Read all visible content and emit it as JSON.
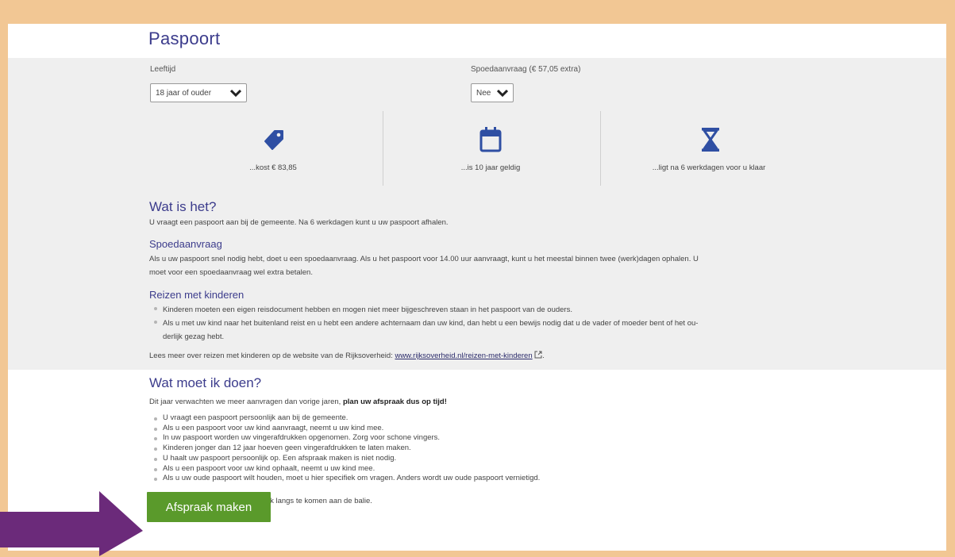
{
  "page": {
    "title": "Paspoort"
  },
  "filters": {
    "age_label": "Leeftijd",
    "age_value": "18 jaar of ouder",
    "speed_label": "Spoedaanvraag (€ 57,05 extra)",
    "speed_value": "Nee"
  },
  "stats": [
    {
      "icon": "price-tag-icon",
      "text": "...kost € 83,85"
    },
    {
      "icon": "calendar-icon",
      "text": "...is 10 jaar geldig"
    },
    {
      "icon": "hourglass-icon",
      "text": "...ligt na 6 werkdagen voor u klaar"
    }
  ],
  "what": {
    "heading": "Wat is het?",
    "text": "U vraagt een paspoort aan bij de gemeente. Na 6 werkdagen kunt u uw paspoort afhalen."
  },
  "spoed": {
    "heading": "Spoedaanvraag",
    "line1": "Als u uw paspoort snel nodig hebt, doet u een spoedaanvraag. Als u het paspoort voor 14.00 uur aanvraagt, kunt u het meestal binnen twee (werk)dagen ophalen. U",
    "line2": "moet voor een spoedaanvraag wel extra betalen."
  },
  "kinderen": {
    "heading": "Reizen met kinderen",
    "bullets": [
      "Kinderen moeten een eigen reisdocument hebben en mogen niet meer bijgeschreven staan in het paspoort van de ouders.",
      "Als u met uw kind naar het buitenland reist en u hebt een andere achternaam dan uw kind, dan hebt u een bewijs nodig dat u de vader of moeder bent of het ou-",
      "derlijk gezag hebt."
    ],
    "more_text": "Lees meer over reizen met kinderen op de website van de Rijksoverheid:",
    "more_link": "www.rijksoverheid.nl/reizen-met-kinderen",
    "more_end": "."
  },
  "todo": {
    "heading": "Wat moet ik doen?",
    "intro": "Dit jaar verwachten we meer aanvragen dan vorige jaren,",
    "intro_bold": "plan uw afspraak dus op tijd!",
    "bullets": [
      "U vraagt een paspoort persoonlijk aan bij de gemeente.",
      "Als u een paspoort voor uw kind aanvraagt, neemt u uw kind mee.",
      "In uw paspoort worden uw vingerafdrukken opgenomen. Zorg voor schone vingers.",
      "Kinderen jonger dan 12 jaar hoeven geen vingerafdrukken te laten maken.",
      "U haalt uw paspoort persoonlijk op. Een afspraak maken is niet nodig.",
      "Als u een paspoort voor uw kind ophaalt, neemt u uw kind mee.",
      "Als u uw oude paspoort wilt houden, moet u hier specifiek om vragen. Anders wordt uw oude paspoort vernietigd."
    ],
    "outro": "U maakt een afspraak om persoonlijk langs te komen aan de balie.",
    "button": "Afspraak maken"
  },
  "colors": {
    "frame": "#f2c794",
    "heading": "#3c3c8c",
    "icon": "#2f4fa3",
    "button": "#5a9a2b",
    "arrow": "#6b2a7a"
  }
}
